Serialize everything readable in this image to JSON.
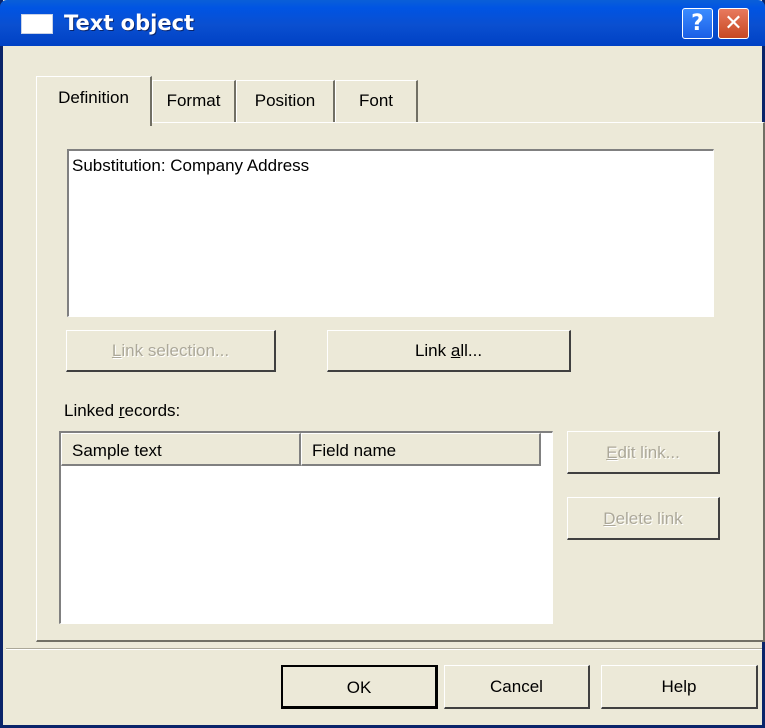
{
  "window": {
    "title": "Text object",
    "help_glyph": "?",
    "close_glyph": "✕"
  },
  "tabs": [
    {
      "label": "Definition",
      "active": true
    },
    {
      "label": "Format",
      "active": false
    },
    {
      "label": "Position",
      "active": false
    },
    {
      "label": "Font",
      "active": false
    }
  ],
  "definition": {
    "text_value": "Substitution: Company Address",
    "link_selection_label_pre": "",
    "link_selection_mnemonic": "L",
    "link_selection_label_post": "ink selection...",
    "link_all_label_pre": "Link ",
    "link_all_mnemonic": "a",
    "link_all_label_post": "ll...",
    "linked_records_label_pre": "Linked ",
    "linked_records_mnemonic": "r",
    "linked_records_label_post": "ecords:",
    "columns": [
      "Sample text",
      "Field name"
    ],
    "edit_link_mnemonic": "E",
    "edit_link_label_post": "dit link...",
    "delete_link_mnemonic": "D",
    "delete_link_label_post": "elete link"
  },
  "footer": {
    "ok_label": "OK",
    "cancel_label": "Cancel",
    "help_label": "Help"
  },
  "icons": {
    "title_icon": "window-icon",
    "help": "help-icon",
    "close": "close-icon"
  }
}
